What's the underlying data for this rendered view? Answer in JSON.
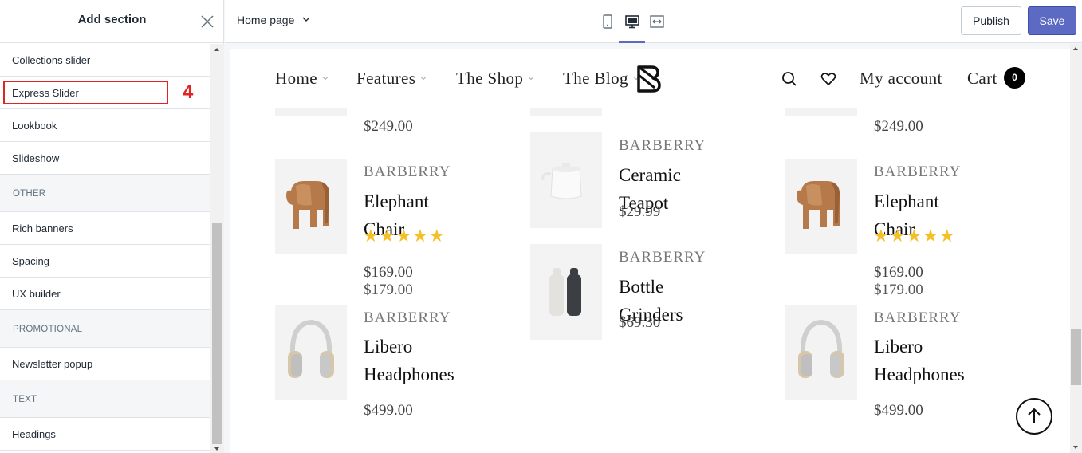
{
  "sidebar": {
    "title": "Add section",
    "items": [
      {
        "label": "Collections slider"
      },
      {
        "label": "Express Slider"
      },
      {
        "label": "Lookbook"
      },
      {
        "label": "Slideshow"
      }
    ],
    "categories": {
      "other": {
        "label": "OTHER",
        "items": [
          {
            "label": "Rich banners"
          },
          {
            "label": "Spacing"
          },
          {
            "label": "UX builder"
          }
        ]
      },
      "promotional": {
        "label": "PROMOTIONAL",
        "items": [
          {
            "label": "Newsletter popup"
          }
        ]
      },
      "text": {
        "label": "TEXT",
        "items": [
          {
            "label": "Headings"
          }
        ]
      }
    },
    "annotation_number": "4"
  },
  "topbar": {
    "page_select": "Home page",
    "publish_label": "Publish",
    "save_label": "Save",
    "active_device": "desktop"
  },
  "nav": {
    "items": [
      {
        "label": "Home"
      },
      {
        "label": "Features"
      },
      {
        "label": "The Shop"
      },
      {
        "label": "The Blog"
      }
    ],
    "account_label": "My account",
    "cart_label": "Cart",
    "cart_count": "0"
  },
  "products": {
    "col1": [
      {
        "price": "$249.00"
      },
      {
        "vendor": "BARBERRY",
        "title": "Elephant Chair",
        "rating": 5,
        "price": "$169.00",
        "compare_price": "$179.00",
        "image": "elephant-chair"
      },
      {
        "vendor": "BARBERRY",
        "title_line1": "Libero",
        "title_line2": "Headphones",
        "price": "$499.00",
        "image": "headphones"
      }
    ],
    "col2": [
      {
        "vendor": "BARBERRY",
        "title": "Ceramic Teapot",
        "price": "$29.99",
        "image": "teapot"
      },
      {
        "vendor": "BARBERRY",
        "title": "Bottle Grinders",
        "price": "$69.30",
        "image": "bottle-grinders"
      }
    ],
    "col3": [
      {
        "price": "$249.00"
      },
      {
        "vendor": "BARBERRY",
        "title": "Elephant Chair",
        "rating": 5,
        "price": "$169.00",
        "compare_price": "$179.00",
        "image": "elephant-chair"
      },
      {
        "vendor": "BARBERRY",
        "title_line1": "Libero",
        "title_line2": "Headphones",
        "price": "$499.00",
        "image": "headphones"
      }
    ],
    "stars": "★★★★★"
  },
  "colors": {
    "accent": "#5c6ac4",
    "annotation": "#e02424",
    "star": "#f4c025"
  }
}
